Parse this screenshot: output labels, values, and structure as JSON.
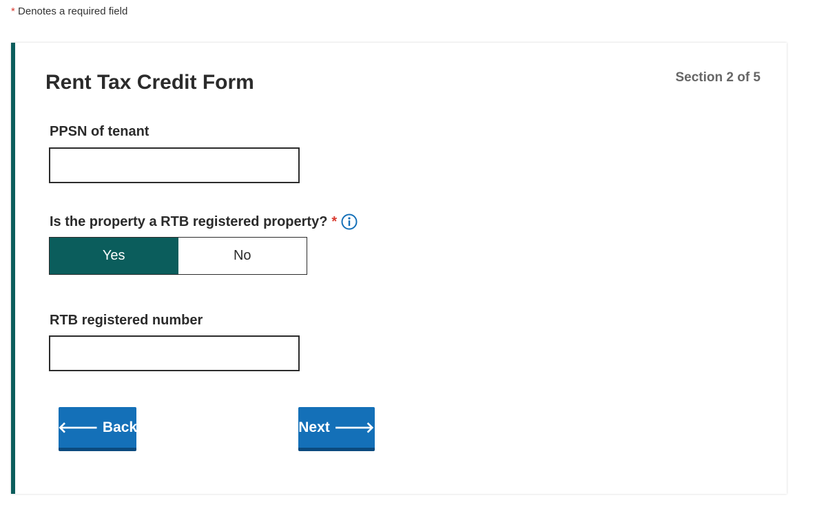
{
  "required_note": {
    "star": "*",
    "text": "Denotes a required field"
  },
  "form": {
    "title": "Rent Tax Credit Form",
    "section": "Section 2 of 5",
    "ppsn": {
      "label": "PPSN of tenant",
      "value": ""
    },
    "rtb_question": {
      "label": "Is the property a RTB registered property?",
      "required_star": "*",
      "info_icon": "info-circle-icon",
      "options": [
        {
          "label": "Yes",
          "selected": true
        },
        {
          "label": "No",
          "selected": false
        }
      ]
    },
    "rtb_number": {
      "label": "RTB registered number",
      "value": ""
    },
    "buttons": {
      "back": {
        "label": "Back",
        "icon": "arrow-left-icon",
        "arrow": "🡐"
      },
      "next": {
        "label": "Next",
        "icon": "arrow-right-icon",
        "arrow": "🡒"
      }
    }
  },
  "colors": {
    "accent_teal": "#0b5d5c",
    "button_blue": "#1470b8",
    "required_red": "#d93a2f",
    "info_blue": "#1470b8"
  }
}
